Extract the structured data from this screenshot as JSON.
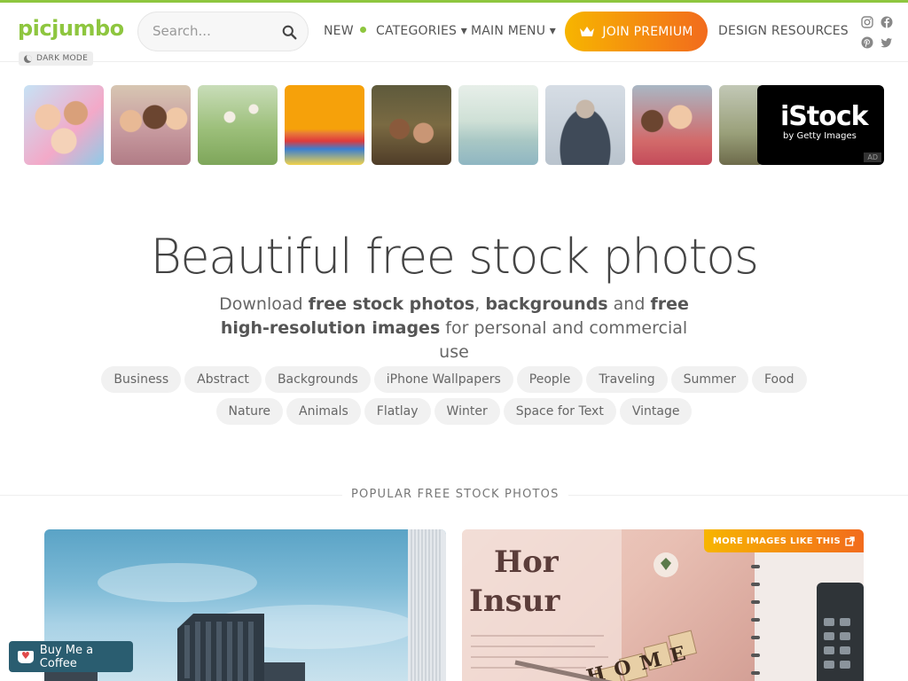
{
  "header": {
    "logo": "picjumbo",
    "dark_mode_label": "DARK MODE",
    "search_placeholder": "Search...",
    "nav": {
      "new_label": "NEW",
      "categories_label": "CATEGORIES ▾",
      "main_menu_label": "MAIN MENU ▾",
      "join_label": "JOIN PREMIUM",
      "design_resources_label": "DESIGN RESOURCES"
    },
    "social_icons": [
      "instagram-icon",
      "facebook-icon",
      "pinterest-icon",
      "twitter-icon"
    ]
  },
  "strip": {
    "ad_brand": "iStock",
    "ad_tagline": "by Getty Images",
    "ad_badge": "AD"
  },
  "hero": {
    "title": "Beautiful free stock photos",
    "sub_1": "Download ",
    "sub_b1": "free stock photos",
    "sub_2": ", ",
    "sub_b2": "backgrounds",
    "sub_3": " and ",
    "sub_b3": "free high-resolution images",
    "sub_4": " for personal and commercial use"
  },
  "tags": {
    "row1": [
      "Business",
      "Abstract",
      "Backgrounds",
      "iPhone Wallpapers",
      "People",
      "Traveling",
      "Summer",
      "Food"
    ],
    "row2": [
      "Nature",
      "Animals",
      "Flatlay",
      "Winter",
      "Space for Text",
      "Vintage"
    ]
  },
  "section": {
    "popular_label": "POPULAR FREE STOCK PHOTOS",
    "more_label": "MORE IMAGES LIKE THIS"
  },
  "right_card_text": {
    "line1": "Hor",
    "line2": "Insur",
    "tiles": "HOME"
  },
  "coffee": {
    "label": "Buy Me a Coffee"
  },
  "colors": {
    "brand_green": "#8ec63f",
    "premium_orange": "#f26b1d",
    "coffee_blue": "#2a5d70"
  }
}
